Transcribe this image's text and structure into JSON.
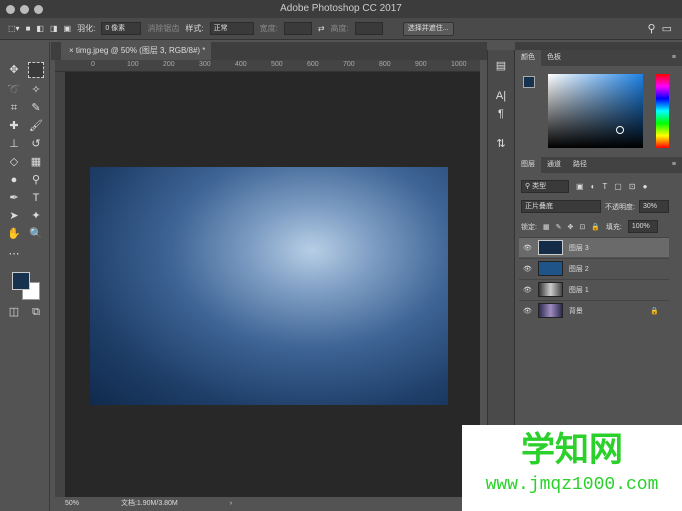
{
  "window": {
    "title": "Adobe Photoshop CC 2017"
  },
  "options": {
    "feather_label": "羽化:",
    "feather_value": "0 像素",
    "antialias": "消除锯齿",
    "style_label": "样式:",
    "style_value": "正常",
    "width_label": "宽度:",
    "height_label": "高度:",
    "select_mask": "选择并遮住..."
  },
  "document": {
    "tab": "timg.jpeg @ 50% (图层 3, RGB/8#) *",
    "ruler_ticks": [
      "0",
      "100",
      "200",
      "300",
      "400",
      "500",
      "600",
      "700",
      "800",
      "900",
      "1000"
    ],
    "zoom": "50%",
    "doc_size": "文档:1.90M/3.80M"
  },
  "colors": {
    "foreground": "#16324f",
    "background": "#ffffff"
  },
  "color_panel": {
    "tabs": [
      "颜色",
      "色板"
    ]
  },
  "layers_panel": {
    "tabs": [
      "图层",
      "通道",
      "路径"
    ],
    "filter": "类型",
    "blend_mode": "正片叠底",
    "opacity_label": "不透明度:",
    "opacity": "30%",
    "lock_label": "锁定:",
    "fill_label": "填充:",
    "fill": "100%",
    "layers": [
      {
        "name": "图层 3",
        "color": "#142c48",
        "selected": true
      },
      {
        "name": "图层 2",
        "color": "#1f5488"
      },
      {
        "name": "图层 1",
        "color": "#8a8a90"
      },
      {
        "name": "背景",
        "color": "#4a3f6a",
        "locked": true
      }
    ]
  },
  "watermark": {
    "title": "学知网",
    "url": "www.jmqz1000.com"
  }
}
